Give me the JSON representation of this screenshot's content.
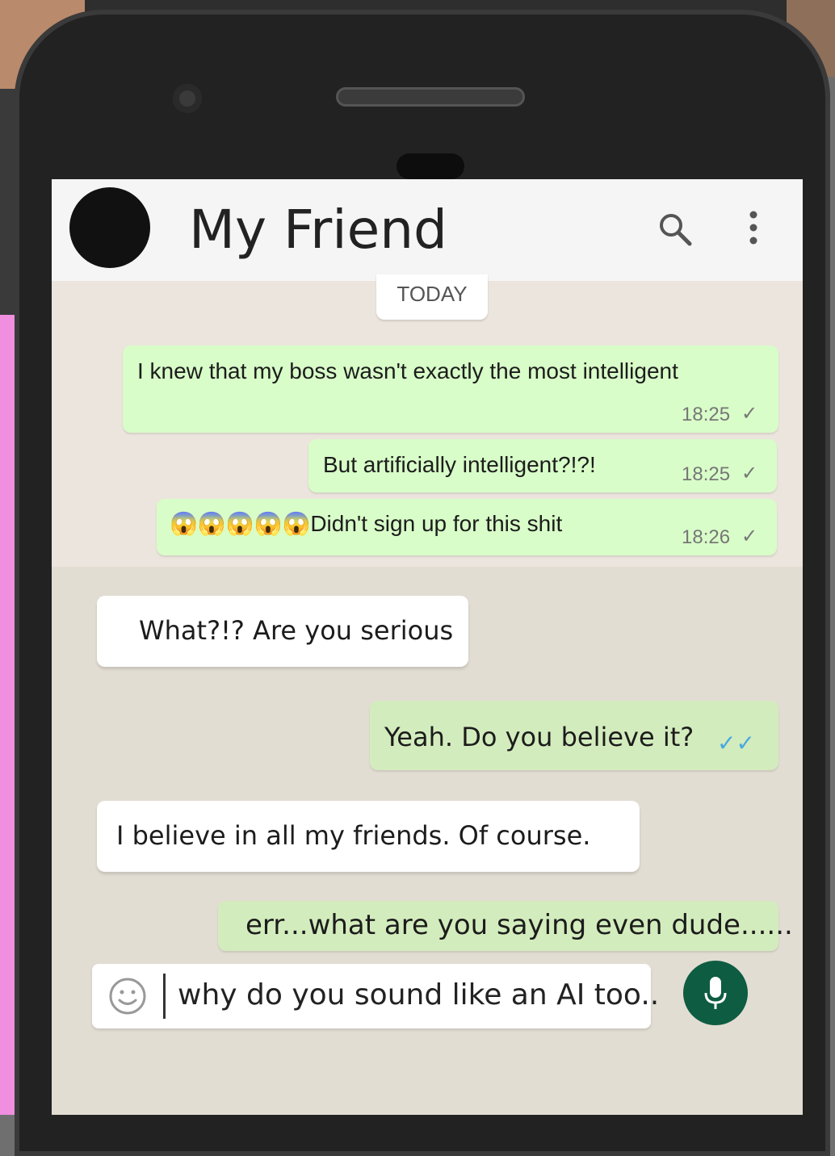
{
  "chat": {
    "contact_name": "My Friend",
    "day_label": "TODAY"
  },
  "messages": [
    {
      "dir": "out",
      "text": "I knew that my boss wasn't exactly the most intelligent",
      "time": "18:25",
      "tick": "✓"
    },
    {
      "dir": "out",
      "text": "But artificially intelligent?!?!",
      "time": "18:25",
      "tick": "✓"
    },
    {
      "dir": "out",
      "text": "😱😱😱😱😱Didn't sign up for this shit",
      "time": "18:26",
      "tick": "✓"
    },
    {
      "dir": "in",
      "text": "What?!? Are you serious"
    },
    {
      "dir": "out",
      "text": "Yeah. Do you believe it?",
      "tick": "✓✓"
    },
    {
      "dir": "in",
      "text": "I believe in all my friends. Of course."
    },
    {
      "dir": "out",
      "text": "err...what are you saying even dude......"
    }
  ],
  "composer": {
    "value": "why do you sound like an AI too.."
  },
  "icons": {
    "search": "search-icon",
    "more": "more-vertical-icon",
    "emoji": "emoji-icon",
    "mic": "mic-icon"
  },
  "colors": {
    "outgoing_bubble": "#d8fdc8",
    "incoming_bubble": "#ffffff",
    "mic_button": "#0e5c42",
    "chat_background": "#ece5dd"
  }
}
